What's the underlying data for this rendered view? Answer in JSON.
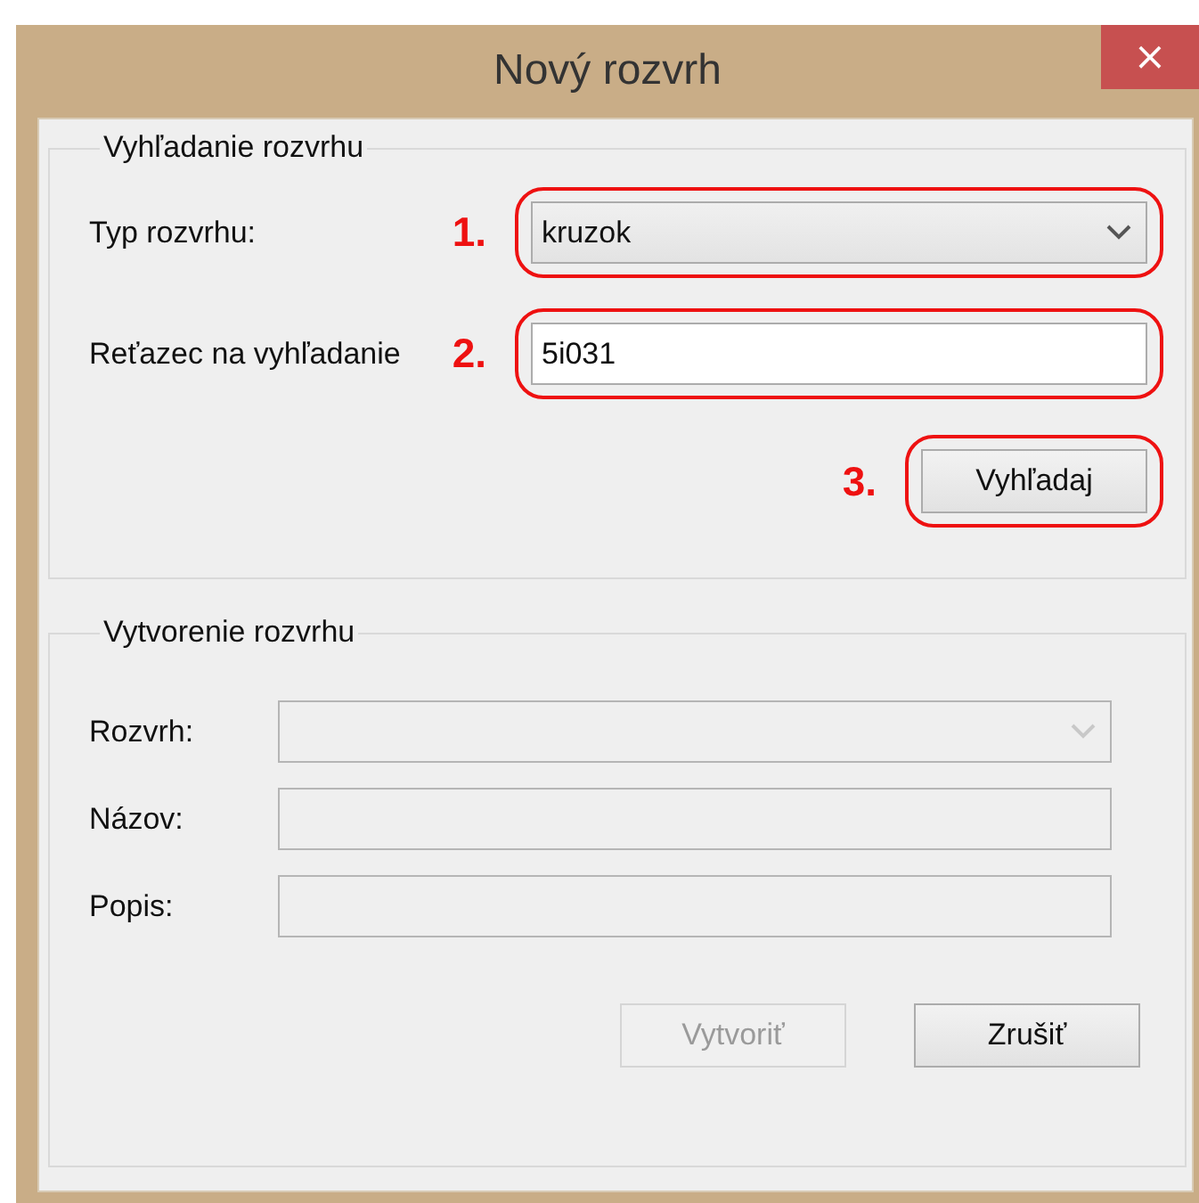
{
  "window": {
    "title": "Nový rozvrh",
    "close": "×"
  },
  "search_group": {
    "legend": "Vyhľadanie rozvrhu",
    "rows": [
      {
        "kind": "select",
        "label": "Typ rozvrhu:",
        "value": "kruzok",
        "annotation": "1."
      },
      {
        "kind": "text",
        "label": "Reťazec na vyhľadanie",
        "value": "5i031",
        "annotation": "2."
      },
      {
        "kind": "button",
        "label": "Vyhľadaj",
        "annotation": "3."
      }
    ]
  },
  "create_group": {
    "legend": "Vytvorenie rozvrhu",
    "rows": [
      {
        "kind": "select",
        "label": "Rozvrh:",
        "disabled": true
      },
      {
        "kind": "text",
        "label": "Názov:",
        "disabled": true
      },
      {
        "kind": "text",
        "label": "Popis:",
        "disabled": true
      }
    ],
    "buttons": [
      {
        "label": "Vytvoriť",
        "disabled": true
      },
      {
        "label": "Zrušiť",
        "disabled": false
      }
    ]
  }
}
